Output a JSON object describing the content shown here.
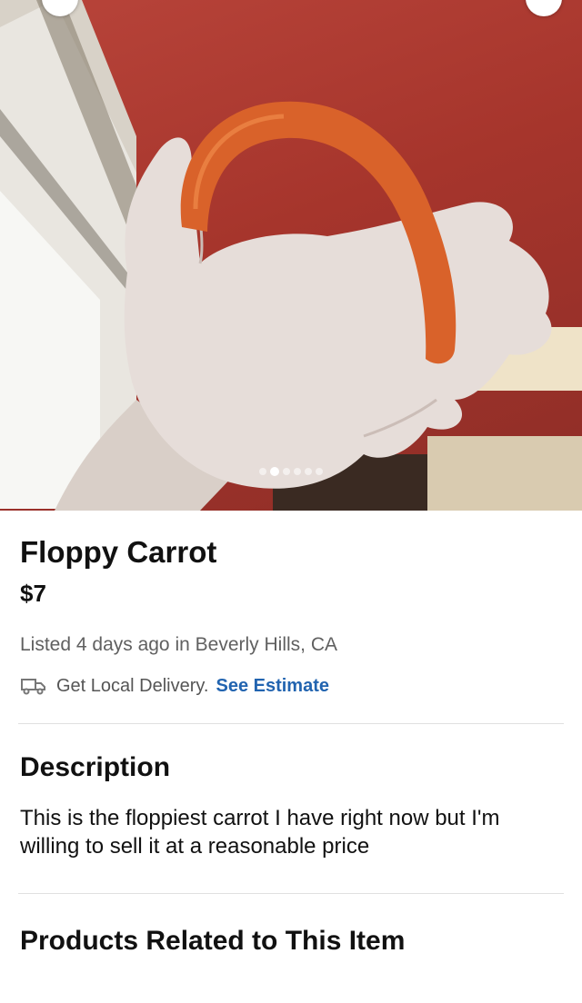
{
  "photo": {
    "dot_count": 6,
    "active_dot": 1
  },
  "listing": {
    "title": "Floppy Carrot",
    "price": "$7",
    "meta": "Listed 4 days ago in Beverly Hills, CA",
    "delivery_text": "Get Local Delivery.",
    "delivery_link": "See Estimate"
  },
  "description": {
    "heading": "Description",
    "text": "This is the floppiest carrot I have right now but I'm willing to sell it at a reasonable price"
  },
  "related": {
    "heading": "Products Related to This Item"
  },
  "icons": {
    "delivery": "truck-icon"
  },
  "colors": {
    "link": "#2264b0",
    "meta": "#606060"
  }
}
